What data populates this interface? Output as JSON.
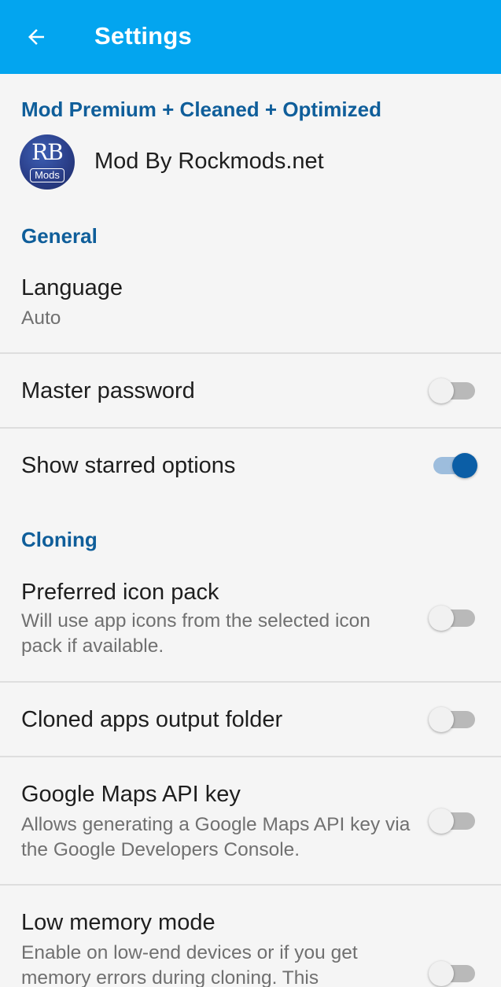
{
  "appbar": {
    "title": "Settings",
    "back_icon": "arrow-left-icon",
    "color": "#03a5ef"
  },
  "mod_section": {
    "header": "Mod Premium + Cleaned + Optimized",
    "logo_text_top": "RB",
    "logo_text_bottom": "Mods",
    "label": "Mod By Rockmods.net"
  },
  "general": {
    "header": "General",
    "language": {
      "title": "Language",
      "value": "Auto"
    },
    "master_password": {
      "title": "Master password",
      "enabled": false
    },
    "show_starred": {
      "title": "Show starred options",
      "enabled": true
    }
  },
  "cloning": {
    "header": "Cloning",
    "icon_pack": {
      "title": "Preferred icon pack",
      "summary": "Will use app icons from the selected icon pack if available.",
      "enabled": false
    },
    "output_folder": {
      "title": "Cloned apps output folder",
      "enabled": false
    },
    "maps_api": {
      "title": "Google Maps API key",
      "summary": "Allows generating a Google Maps API key via the Google Developers Console.",
      "enabled": false
    },
    "low_memory": {
      "title": "Low memory mode",
      "summary": "Enable on low-end devices or if you get memory errors during cloning. This",
      "enabled": false
    }
  },
  "colors": {
    "section_header": "#0f5e9a",
    "toggle_on_thumb": "#0b5ea6",
    "toggle_on_track": "#9dbddd",
    "toggle_off_track": "#b9b9b9"
  }
}
